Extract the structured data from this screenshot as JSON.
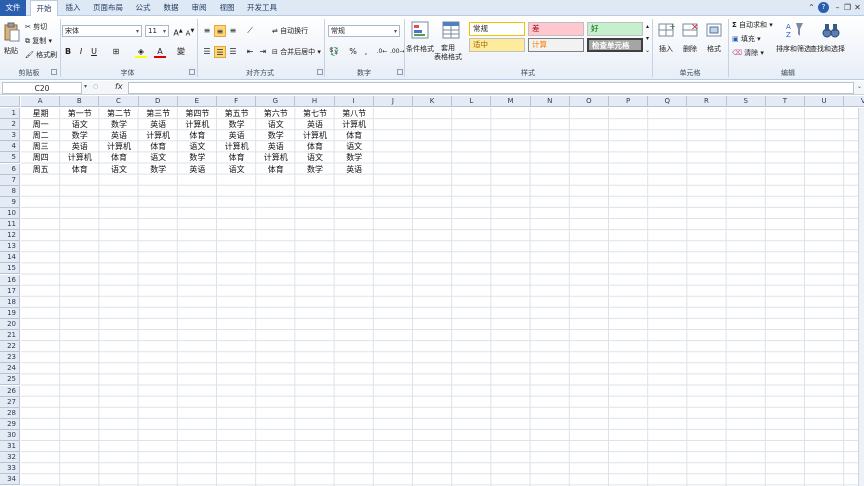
{
  "menu": {
    "tabs": [
      "文件",
      "开始",
      "插入",
      "页面布局",
      "公式",
      "数据",
      "审阅",
      "视图",
      "开发工具"
    ]
  },
  "ribbon": {
    "clipboard": {
      "paste": "粘贴",
      "cut": "剪切",
      "copy": "复制 ▾",
      "format_painter": "格式刷",
      "label": "剪贴板"
    },
    "font": {
      "name": "宋体",
      "size": "11",
      "label": "字体"
    },
    "alignment": {
      "wrap": "自动换行",
      "merge": "合并后居中 ▾",
      "label": "对齐方式"
    },
    "number": {
      "format": "常规",
      "label": "数字"
    },
    "styles": {
      "conditional": "条件格式",
      "table": "套用\n表格格式",
      "cells": [
        "常规",
        "差",
        "好",
        "适中",
        "计算",
        "检查单元格"
      ],
      "label": "样式"
    },
    "cells_group": {
      "insert": "插入",
      "delete": "删除",
      "format": "格式",
      "label": "单元格"
    },
    "editing": {
      "autosum": "自动求和 ▾",
      "fill": "填充 ▾",
      "clear": "清除 ▾",
      "sort": "排序和筛选",
      "find": "查找和选择",
      "label": "编辑"
    }
  },
  "formula_bar": {
    "name_box": "C20",
    "fx": "fx",
    "value": ""
  },
  "grid": {
    "columns": [
      "A",
      "B",
      "C",
      "D",
      "E",
      "F",
      "G",
      "H",
      "I",
      "J",
      "K",
      "L",
      "M",
      "N",
      "O",
      "P",
      "Q",
      "R",
      "S",
      "T",
      "U",
      "V"
    ],
    "rows": [
      "1",
      "2",
      "3",
      "4",
      "5",
      "6",
      "7",
      "8",
      "9",
      "10",
      "11",
      "12",
      "13",
      "14",
      "15",
      "16",
      "17",
      "18",
      "19",
      "20",
      "21",
      "22",
      "23",
      "24",
      "25",
      "26",
      "27",
      "28",
      "29",
      "30",
      "31",
      "32",
      "33",
      "34"
    ],
    "data": [
      [
        "星期",
        "第一节",
        "第二节",
        "第三节",
        "第四节",
        "第五节",
        "第六节",
        "第七节",
        "第八节"
      ],
      [
        "周一",
        "语文",
        "数学",
        "英语",
        "计算机",
        "数学",
        "语文",
        "英语",
        "计算机"
      ],
      [
        "周二",
        "数学",
        "英语",
        "计算机",
        "体育",
        "英语",
        "数学",
        "计算机",
        "体育"
      ],
      [
        "周三",
        "英语",
        "计算机",
        "体育",
        "语文",
        "计算机",
        "英语",
        "体育",
        "语文"
      ],
      [
        "周四",
        "计算机",
        "体育",
        "语文",
        "数学",
        "体育",
        "计算机",
        "语文",
        "数学"
      ],
      [
        "周五",
        "体育",
        "语文",
        "数学",
        "英语",
        "语文",
        "体育",
        "数学",
        "英语"
      ]
    ]
  },
  "colors": {
    "ribbon_bg": "#e8eef7",
    "file_tab": "#2a5fb0",
    "bad_bg": "#ffc7ce",
    "bad_fg": "#9c0006",
    "good_bg": "#c6efce",
    "good_fg": "#006100",
    "neutral_bg": "#ffeb9c",
    "neutral_fg": "#9c6500",
    "calc_fg": "#fa7d00",
    "check_bg": "#a5a5a5"
  }
}
